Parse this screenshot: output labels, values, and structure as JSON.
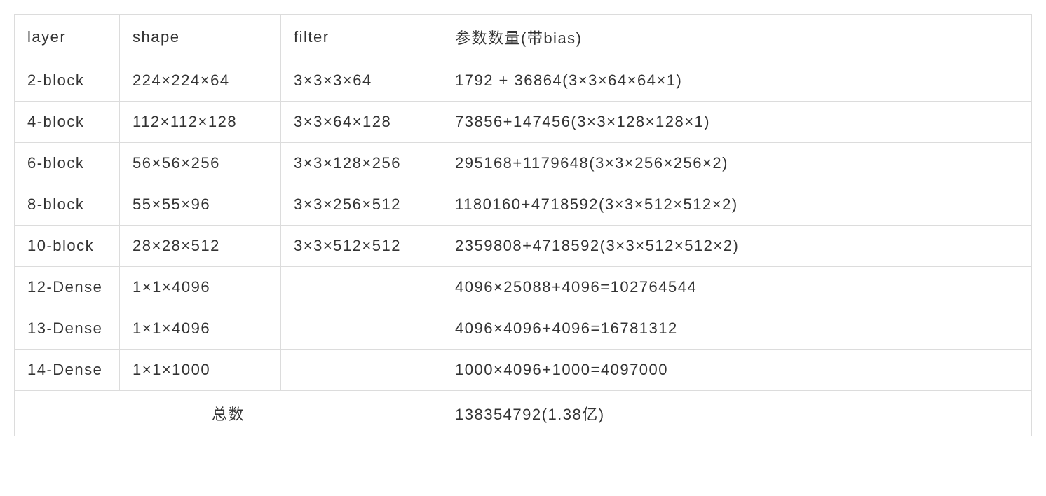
{
  "table": {
    "headers": {
      "layer": "layer",
      "shape": "shape",
      "filter": "filter",
      "params": "参数数量(带bias)"
    },
    "rows": [
      {
        "layer": "2-block",
        "shape": "224×224×64",
        "filter": "3×3×3×64",
        "params": "1792 + 36864(3×3×64×64×1)"
      },
      {
        "layer": "4-block",
        "shape": "112×112×128",
        "filter": "3×3×64×128",
        "params": "73856+147456(3×3×128×128×1)"
      },
      {
        "layer": "6-block",
        "shape": "56×56×256",
        "filter": "3×3×128×256",
        "params": "295168+1179648(3×3×256×256×2)"
      },
      {
        "layer": "8-block",
        "shape": "55×55×96",
        "filter": "3×3×256×512",
        "params": "1180160+4718592(3×3×512×512×2)"
      },
      {
        "layer": "10-block",
        "shape": "28×28×512",
        "filter": "3×3×512×512",
        "params": "2359808+4718592(3×3×512×512×2)"
      },
      {
        "layer": "12-Dense",
        "shape": "1×1×4096",
        "filter": "",
        "params": "4096×25088+4096=102764544"
      },
      {
        "layer": "13-Dense",
        "shape": "1×1×4096",
        "filter": "",
        "params": "4096×4096+4096=16781312"
      },
      {
        "layer": "14-Dense",
        "shape": "1×1×1000",
        "filter": "",
        "params": "1000×4096+1000=4097000"
      }
    ],
    "total": {
      "label": "总数",
      "value": "138354792(1.38亿)"
    }
  }
}
